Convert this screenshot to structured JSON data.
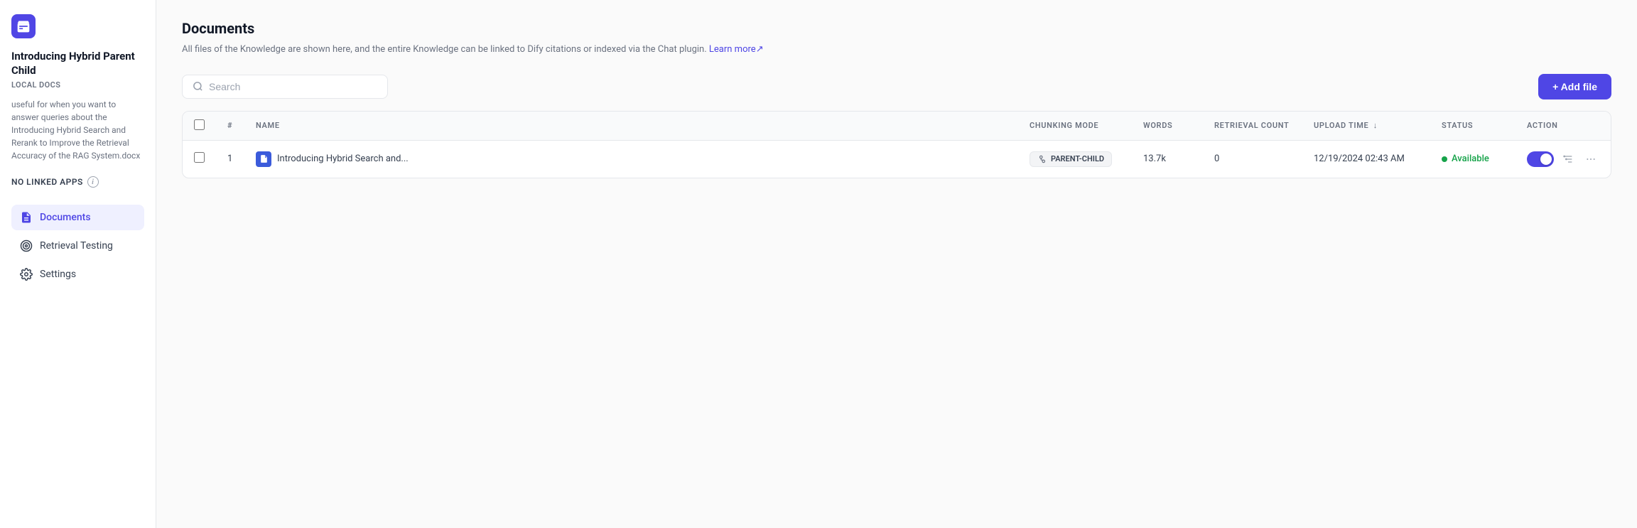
{
  "sidebar": {
    "logo_label": "Knowledge base icon",
    "title": "Introducing Hybrid Parent Child",
    "subtitle": "LOCAL DOCS",
    "description": "useful for when you want to answer queries about the Introducing Hybrid Search and Rerank to Improve the Retrieval Accuracy of the RAG System.docx",
    "no_linked_apps": "NO LINKED APPS",
    "nav": [
      {
        "id": "documents",
        "label": "Documents",
        "icon": "document-icon",
        "active": true
      },
      {
        "id": "retrieval-testing",
        "label": "Retrieval Testing",
        "icon": "target-icon",
        "active": false
      },
      {
        "id": "settings",
        "label": "Settings",
        "icon": "gear-icon",
        "active": false
      }
    ]
  },
  "main": {
    "title": "Documents",
    "description": "All files of the Knowledge are shown here, and the entire Knowledge can be linked to Dify citations or indexed via the Chat plugin.",
    "learn_more_label": "Learn more",
    "search_placeholder": "Search",
    "add_file_label": "+ Add file",
    "table": {
      "headers": [
        {
          "id": "checkbox",
          "label": ""
        },
        {
          "id": "num",
          "label": "#"
        },
        {
          "id": "name",
          "label": "NAME"
        },
        {
          "id": "chunking",
          "label": "CHUNKING MODE"
        },
        {
          "id": "words",
          "label": "WORDS"
        },
        {
          "id": "retrieval",
          "label": "RETRIEVAL COUNT"
        },
        {
          "id": "upload",
          "label": "UPLOAD TIME"
        },
        {
          "id": "status",
          "label": "STATUS"
        },
        {
          "id": "action",
          "label": "ACTION"
        }
      ],
      "rows": [
        {
          "num": "1",
          "name": "Introducing Hybrid Search and...",
          "chunking_mode": "PARENT-CHILD",
          "words": "13.7k",
          "retrieval_count": "0",
          "upload_time": "12/19/2024 02:43 AM",
          "status": "Available",
          "toggle_on": true
        }
      ]
    }
  }
}
